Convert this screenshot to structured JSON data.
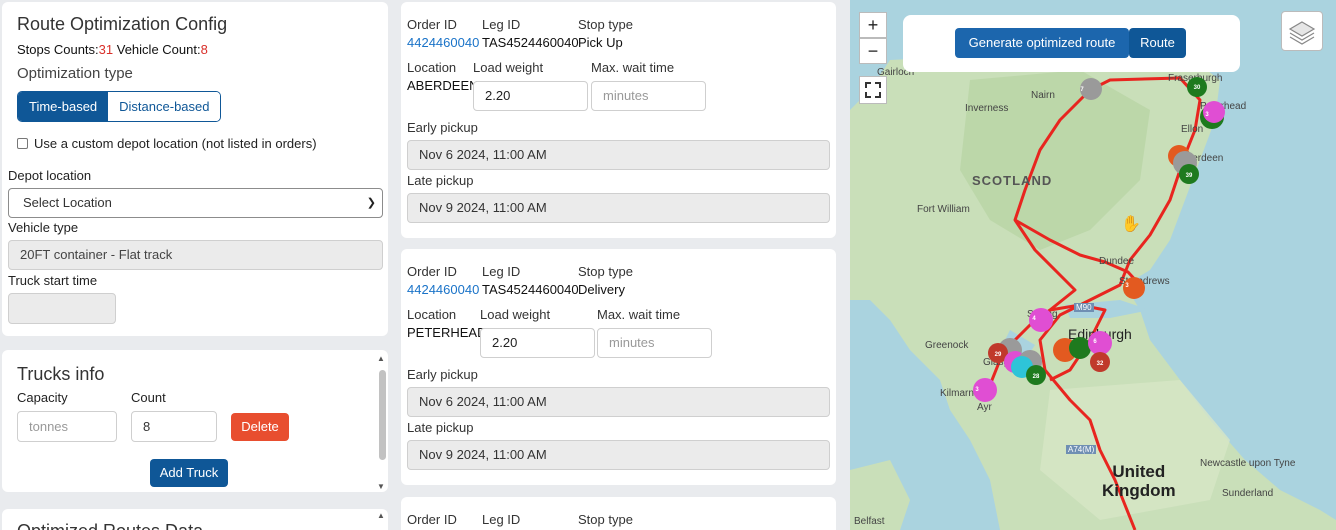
{
  "config": {
    "title": "Route Optimization Config",
    "stops_label": "Stops Counts:",
    "stops_count": "31",
    "vehicle_label": "Vehicle Count:",
    "vehicle_count": "8",
    "optimization_type_label": "Optimization type",
    "optimization_options": [
      "Time-based",
      "Distance-based"
    ],
    "optimization_selected": "Time-based",
    "custom_depot_label": "Use a custom depot location (not listed in orders)",
    "depot_location_label": "Depot location",
    "depot_location_value": "Select Location",
    "vehicle_type_label": "Vehicle type",
    "vehicle_type_value": "20FT container - Flat track",
    "truck_start_label": "Truck start time"
  },
  "trucks": {
    "title": "Trucks info",
    "capacity_label": "Capacity",
    "capacity_placeholder": "tonnes",
    "count_label": "Count",
    "count_value": "8",
    "delete_label": "Delete",
    "add_label": "Add Truck"
  },
  "optimized": {
    "title": "Optimized Routes Data"
  },
  "orders": [
    {
      "order_id_label": "Order ID",
      "order_id": "4424460040",
      "leg_id_label": "Leg ID",
      "leg_id": "TAS4524460040",
      "stop_type_label": "Stop type",
      "stop_type": "Pick Up",
      "location_label": "Location",
      "location": "ABERDEEN",
      "load_weight_label": "Load weight",
      "load_weight": "2.20",
      "max_wait_label": "Max. wait time",
      "max_wait_placeholder": "minutes",
      "early_pickup_label": "Early pickup",
      "early_pickup": "Nov 6 2024, 11:00 AM",
      "late_pickup_label": "Late pickup",
      "late_pickup": "Nov 9 2024, 11:00 AM"
    },
    {
      "order_id_label": "Order ID",
      "order_id": "4424460040",
      "leg_id_label": "Leg ID",
      "leg_id": "TAS4524460040",
      "stop_type_label": "Stop type",
      "stop_type": "Delivery",
      "location_label": "Location",
      "location": "PETERHEAD",
      "load_weight_label": "Load weight",
      "load_weight": "2.20",
      "max_wait_label": "Max. wait time",
      "max_wait_placeholder": "minutes",
      "early_pickup_label": "Early pickup",
      "early_pickup": "Nov 6 2024, 11:00 AM",
      "late_pickup_label": "Late pickup",
      "late_pickup": "Nov 9 2024, 11:00 AM"
    },
    {
      "order_id_label": "Order ID",
      "leg_id_label": "Leg ID",
      "stop_type_label": "Stop type"
    }
  ],
  "map": {
    "zoom_in": "+",
    "zoom_out": "−",
    "generate_label": "Generate optimized route",
    "route_label": "Route",
    "labels": {
      "scotland": "SCOTLAND",
      "edinburgh": "Edinburgh",
      "dundee": "Dundee",
      "uk_line1": "United",
      "uk_line2": "Kingdom",
      "inverness": "Inverness",
      "nairn": "Nairn",
      "fort_william": "Fort William",
      "gairloch": "Gairloch",
      "fraserburgh": "Fraserburgh",
      "peterhead": "Peterhead",
      "ellon": "Ellon",
      "aberdeen": "Aberdeen",
      "st_andrews": "St Andrews",
      "stirling": "Stirling",
      "greenock": "Greenock",
      "glasgow": "Glasgow",
      "kilmarnock": "Kilmarnock",
      "ayr": "Ayr",
      "newcastle": "Newcastle upon Tyne",
      "sunderland": "Sunderland",
      "belfast": "Belfast",
      "m90": "M90",
      "a74m": "A74(M)"
    },
    "markers": [
      "30",
      "3",
      "39",
      "7",
      "3",
      "4",
      "29",
      "6",
      "32",
      "28",
      "3"
    ],
    "colors": {
      "route": "#e8251f",
      "primary": "#0f5797",
      "delete": "#e84e2f",
      "marker_green": "#1e7a1e",
      "marker_pink": "#e04ed3",
      "marker_red": "#c0392b",
      "marker_orange": "#e35a20",
      "marker_grey": "#9a9a9a",
      "marker_cyan": "#2ec4d8"
    }
  }
}
